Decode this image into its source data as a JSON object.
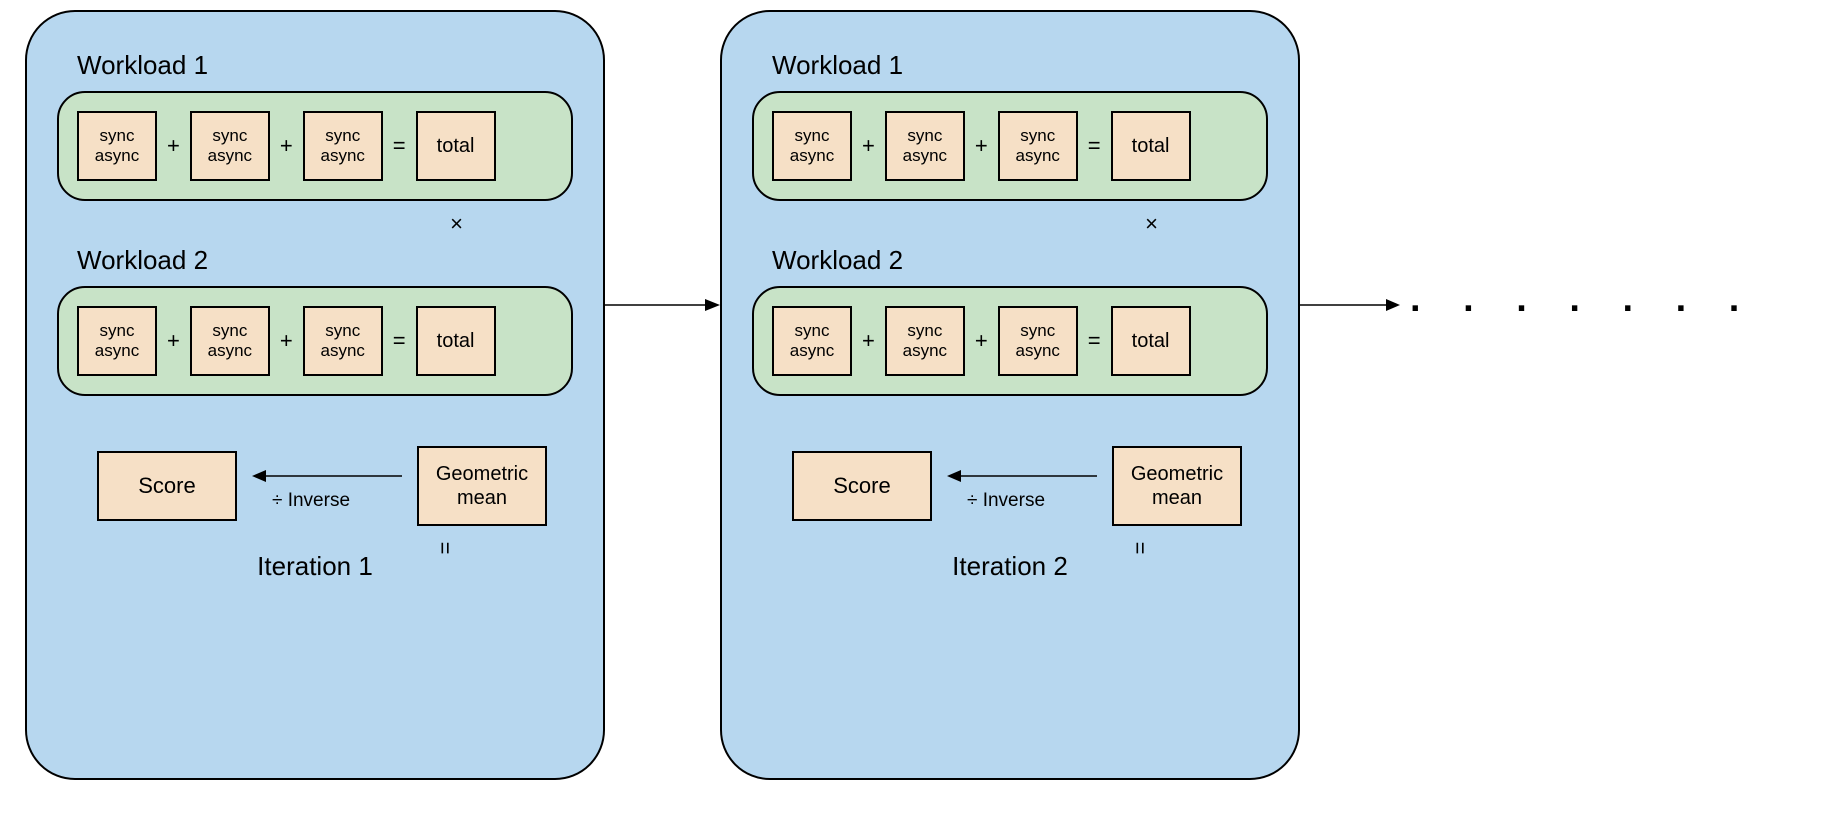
{
  "iterations": [
    {
      "title": "Iteration 1",
      "workloads": [
        {
          "label": "Workload 1",
          "cells": [
            {
              "l1": "sync",
              "l2": "async"
            },
            {
              "l1": "sync",
              "l2": "async"
            },
            {
              "l1": "sync",
              "l2": "async"
            }
          ],
          "total": "total"
        },
        {
          "label": "Workload 2",
          "cells": [
            {
              "l1": "sync",
              "l2": "async"
            },
            {
              "l1": "sync",
              "l2": "async"
            },
            {
              "l1": "sync",
              "l2": "async"
            }
          ],
          "total": "total"
        }
      ],
      "multiply": "×",
      "equals": "=",
      "gmean_l1": "Geometric",
      "gmean_l2": "mean",
      "inverse": "÷ Inverse",
      "score": "Score"
    },
    {
      "title": "Iteration 2",
      "workloads": [
        {
          "label": "Workload 1",
          "cells": [
            {
              "l1": "sync",
              "l2": "async"
            },
            {
              "l1": "sync",
              "l2": "async"
            },
            {
              "l1": "sync",
              "l2": "async"
            }
          ],
          "total": "total"
        },
        {
          "label": "Workload 2",
          "cells": [
            {
              "l1": "sync",
              "l2": "async"
            },
            {
              "l1": "sync",
              "l2": "async"
            },
            {
              "l1": "sync",
              "l2": "async"
            }
          ],
          "total": "total"
        }
      ],
      "multiply": "×",
      "equals": "=",
      "gmean_l1": "Geometric",
      "gmean_l2": "mean",
      "inverse": "÷ Inverse",
      "score": "Score"
    }
  ],
  "ops": {
    "plus": "+",
    "eq": "="
  },
  "continuation": ". . . . . . ."
}
